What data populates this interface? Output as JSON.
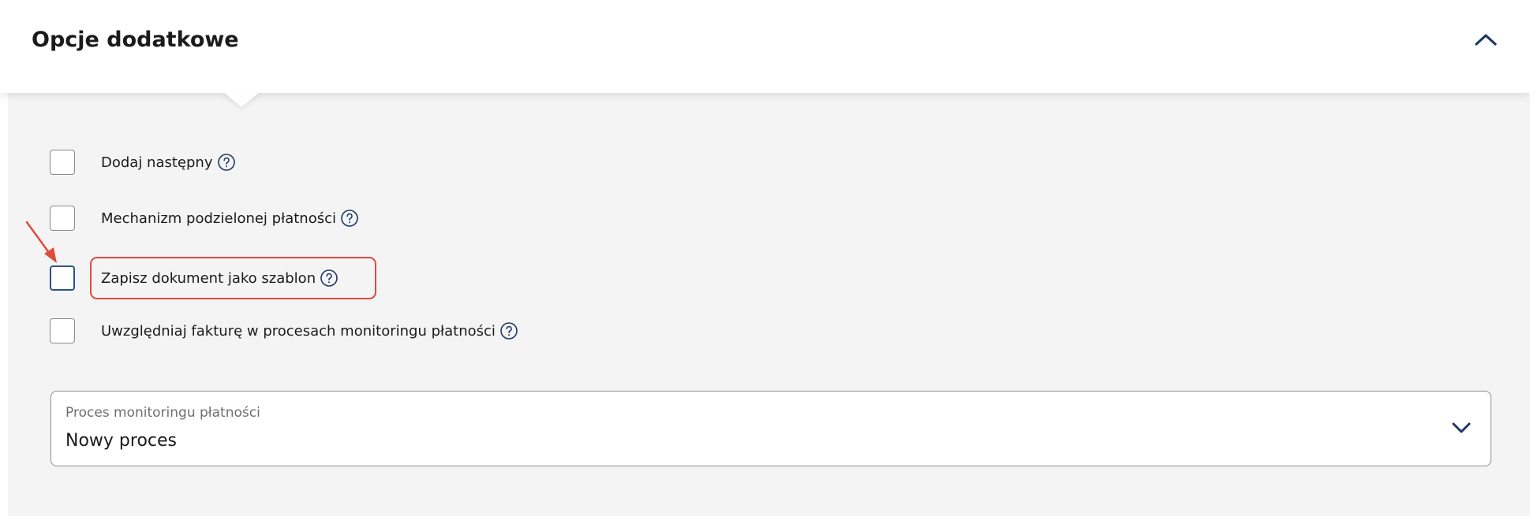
{
  "section": {
    "title": "Opcje dodatkowe",
    "toggle_icon": "chevron-up-icon"
  },
  "options": [
    {
      "label": "Dodaj następny",
      "checked": false,
      "help_icon": "question-circle-icon"
    },
    {
      "label": "Mechanizm podzielonej płatności",
      "checked": false,
      "help_icon": "question-circle-icon"
    },
    {
      "label": "Zapisz dokument jako szablon",
      "checked": false,
      "focused": true,
      "highlighted": true,
      "help_icon": "question-circle-icon"
    },
    {
      "label": "Uwzględniaj fakturę w procesach monitoringu płatności",
      "checked": false,
      "help_icon": "question-circle-icon"
    }
  ],
  "monitoring_select": {
    "label": "Proces monitoringu płatności",
    "value": "Nowy proces",
    "icon": "chevron-down-icon"
  },
  "colors": {
    "panel_bg": "#f4f4f4",
    "header_bg": "#ffffff",
    "text": "#1b1b1b",
    "icon_navy": "#1f3864",
    "focus_border": "#2b5388",
    "annotation_red": "#e04b3e"
  }
}
